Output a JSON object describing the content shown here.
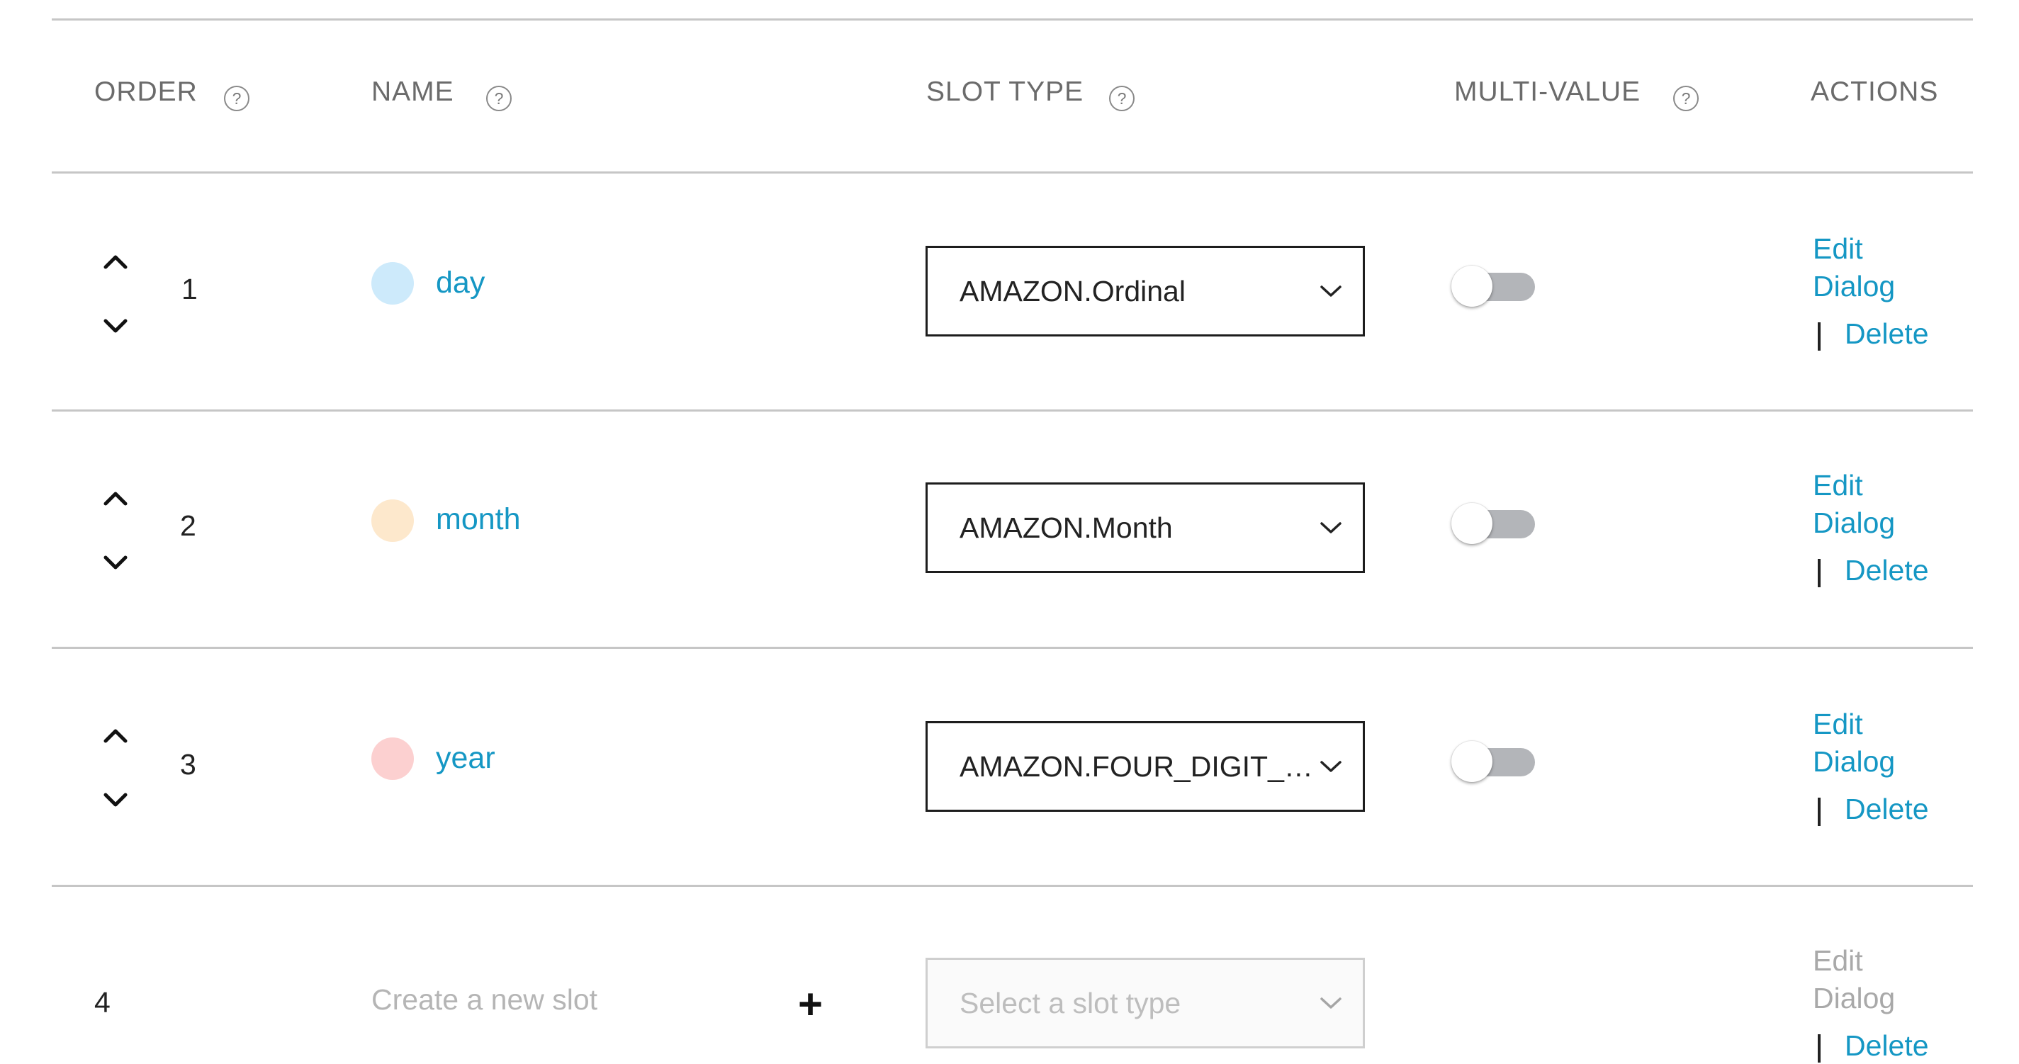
{
  "header": {
    "order": "ORDER",
    "name": "NAME",
    "slot_type": "SLOT TYPE",
    "multi_value": "MULTI-VALUE",
    "actions": "ACTIONS",
    "help_glyph": "?"
  },
  "slots": [
    {
      "order": "1",
      "name": "day",
      "dot_color": "#cdeafb",
      "slot_type": "AMAZON.Ordinal",
      "multi_value": false,
      "edit_label": "Edit",
      "dialog_label": "Dialog",
      "delete_label": "Delete"
    },
    {
      "order": "2",
      "name": "month",
      "dot_color": "#fde8cc",
      "slot_type": "AMAZON.Month",
      "multi_value": false,
      "edit_label": "Edit",
      "dialog_label": "Dialog",
      "delete_label": "Delete"
    },
    {
      "order": "3",
      "name": "year",
      "dot_color": "#fcd0d0",
      "slot_type": "AMAZON.FOUR_DIGIT_NUMBER",
      "multi_value": false,
      "edit_label": "Edit",
      "dialog_label": "Dialog",
      "delete_label": "Delete"
    }
  ],
  "new_slot": {
    "order": "4",
    "name_placeholder": "Create a new slot",
    "plus_glyph": "+",
    "slot_type_placeholder": "Select a slot type",
    "edit_label": "Edit",
    "dialog_label": "Dialog",
    "delete_label": "Delete"
  },
  "icons": {
    "help": "help-circle-icon",
    "move_up": "chevron-up-icon",
    "move_down": "chevron-down-icon",
    "select_caret": "chevron-down-icon",
    "add": "plus-icon"
  },
  "colors": {
    "link": "#1597c4",
    "divider": "#c6c6c6",
    "toggle_off": "#b3b5b9",
    "disabled_text": "#b5b5b5"
  }
}
